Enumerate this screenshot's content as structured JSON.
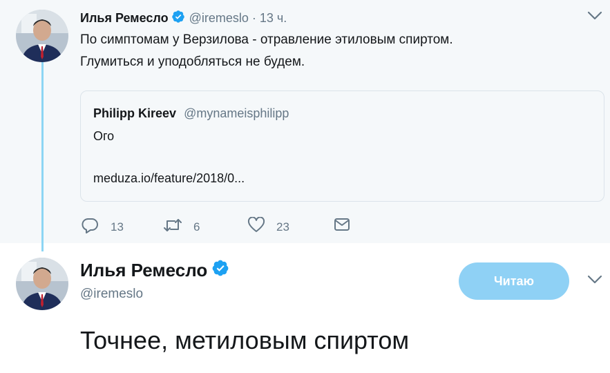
{
  "parent_tweet": {
    "author_name": "Илья Ремесло",
    "handle": "@iremeslo",
    "separator": "·",
    "time": "13 ч.",
    "text_line1": "По симптомам у Верзилова - отравление этиловым спиртом.",
    "text_line2": "Глумиться и уподобляться не будем.",
    "quote": {
      "author_name": "Philipp Kireev",
      "handle": "@mynameisphilipp",
      "text": "Ого",
      "link": "meduza.io/feature/2018/0..."
    },
    "actions": {
      "replies": "13",
      "retweets": "6",
      "likes": "23"
    }
  },
  "main_tweet": {
    "author_name": "Илья Ремесло",
    "handle": "@iremeslo",
    "follow_label": "Читаю",
    "text": "Точнее, метиловым спиртом"
  },
  "colors": {
    "accent": "#1da1f2",
    "follow_button": "#8fd1f5",
    "thread_line": "#8cd5f4",
    "secondary_text": "#657786",
    "parent_background": "#f5f8fa"
  },
  "icons": [
    "verified-badge-icon",
    "chevron-down-icon",
    "reply-icon",
    "retweet-icon",
    "like-icon",
    "direct-message-icon"
  ]
}
